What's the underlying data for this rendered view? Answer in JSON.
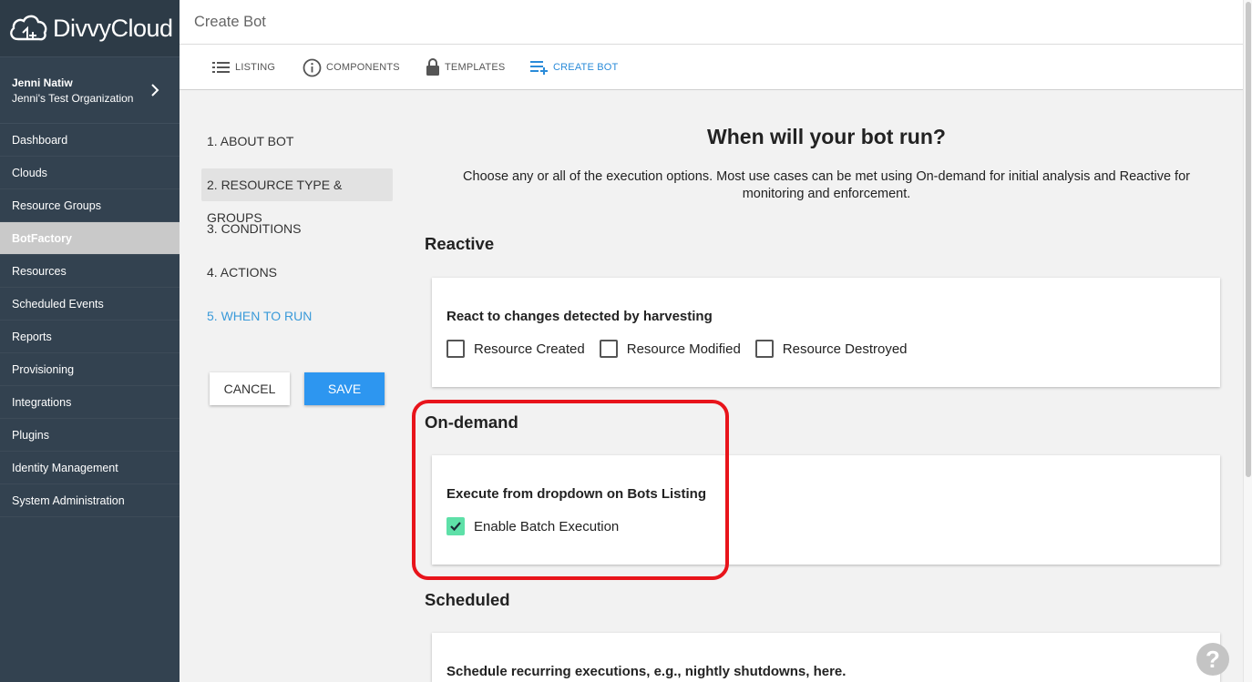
{
  "app": {
    "name": "DivvyCloud"
  },
  "user": {
    "name": "Jenni Natiw",
    "organization": "Jenni's Test Organization"
  },
  "sidebar": {
    "items": [
      {
        "label": "Dashboard"
      },
      {
        "label": "Clouds"
      },
      {
        "label": "Resource Groups"
      },
      {
        "label": "BotFactory",
        "active": true
      },
      {
        "label": "Resources"
      },
      {
        "label": "Scheduled Events"
      },
      {
        "label": "Reports"
      },
      {
        "label": "Provisioning"
      },
      {
        "label": "Integrations"
      },
      {
        "label": "Plugins"
      },
      {
        "label": "Identity Management"
      },
      {
        "label": "System Administration"
      }
    ]
  },
  "header": {
    "title": "Create Bot"
  },
  "tabs": [
    {
      "label": "LISTING",
      "icon": "list-icon"
    },
    {
      "label": "COMPONENTS",
      "icon": "info-icon"
    },
    {
      "label": "TEMPLATES",
      "icon": "lock-icon"
    },
    {
      "label": "CREATE BOT",
      "icon": "add-list-icon",
      "active": true
    }
  ],
  "steps": [
    {
      "label": "1. ABOUT BOT"
    },
    {
      "label": "2. RESOURCE TYPE & GROUPS"
    },
    {
      "label": "3. CONDITIONS"
    },
    {
      "label": "4. ACTIONS"
    },
    {
      "label": "5. WHEN TO RUN"
    }
  ],
  "buttons": {
    "cancel": "CANCEL",
    "save": "SAVE"
  },
  "main": {
    "heading": "When will your bot run?",
    "description": "Choose any or all of the execution options. Most use cases can be met using On-demand for initial analysis and Reactive for monitoring and enforcement.",
    "reactive": {
      "heading": "Reactive",
      "card_title": "React to changes detected by harvesting",
      "options": [
        {
          "label": "Resource Created",
          "checked": false
        },
        {
          "label": "Resource Modified",
          "checked": false
        },
        {
          "label": "Resource Destroyed",
          "checked": false
        }
      ]
    },
    "ondemand": {
      "heading": "On-demand",
      "card_title": "Execute from dropdown on Bots Listing",
      "options": [
        {
          "label": "Enable Batch Execution",
          "checked": true
        }
      ]
    },
    "scheduled": {
      "heading": "Scheduled",
      "card_title": "Schedule recurring executions, e.g., nightly shutdowns, here."
    }
  },
  "help": {
    "label": "?"
  },
  "colors": {
    "accent": "#2d96f0",
    "sidebar": "#334250",
    "checked": "#5ee0a8",
    "highlight": "#e8141b"
  }
}
